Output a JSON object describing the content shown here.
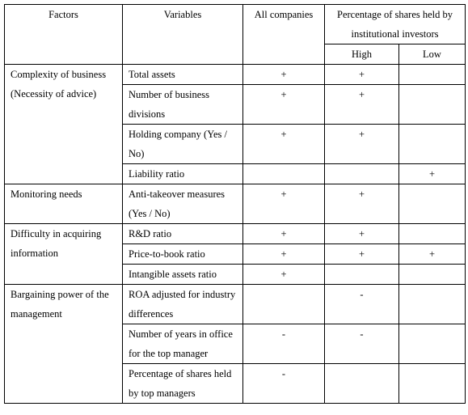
{
  "header": {
    "factors": "Factors",
    "variables": "Variables",
    "all_companies": "All companies",
    "institutional": "Percentage of shares held by institutional investors",
    "high": "High",
    "low": "Low"
  },
  "groups": [
    {
      "factor": "Complexity of business (Necessity of advice)",
      "rows": [
        {
          "variable": "Total assets",
          "all": "+",
          "high": "+",
          "low": ""
        },
        {
          "variable": "Number of business divisions",
          "all": "+",
          "high": "+",
          "low": ""
        },
        {
          "variable": "Holding company (Yes / No)",
          "all": "+",
          "high": "+",
          "low": ""
        },
        {
          "variable": "Liability ratio",
          "all": "",
          "high": "",
          "low": "+"
        }
      ]
    },
    {
      "factor": "Monitoring needs",
      "rows": [
        {
          "variable": "Anti-takeover measures (Yes / No)",
          "all": "+",
          "high": "+",
          "low": ""
        }
      ]
    },
    {
      "factor": "Difficulty in acquiring information",
      "rows": [
        {
          "variable": "R&D ratio",
          "all": "+",
          "high": "+",
          "low": ""
        },
        {
          "variable": "Price-to-book ratio",
          "all": "+",
          "high": "+",
          "low": "+"
        },
        {
          "variable": "Intangible assets ratio",
          "all": "+",
          "high": "",
          "low": ""
        }
      ]
    },
    {
      "factor": "Bargaining power of the management",
      "rows": [
        {
          "variable": "ROA adjusted for industry differences",
          "all": "",
          "high": "-",
          "low": ""
        },
        {
          "variable": "Number of years in office for the top manager",
          "all": "-",
          "high": "-",
          "low": ""
        },
        {
          "variable": "Percentage of shares held by top managers",
          "all": "-",
          "high": "",
          "low": ""
        }
      ]
    }
  ]
}
